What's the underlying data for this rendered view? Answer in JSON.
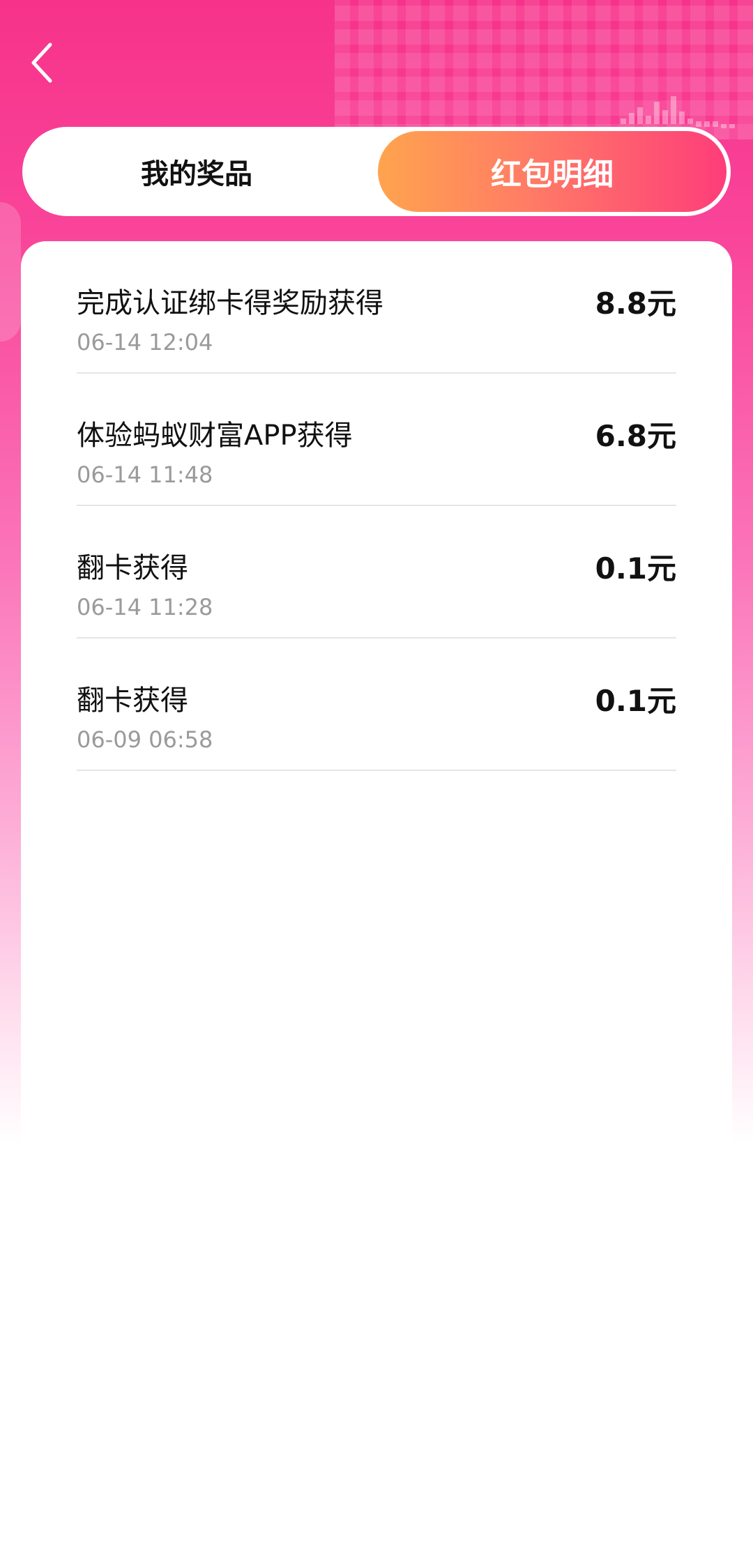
{
  "header": {
    "back_icon": "chevron-left-icon"
  },
  "tabs": [
    {
      "label": "我的奖品",
      "active": false
    },
    {
      "label": "红包明细",
      "active": true
    }
  ],
  "records": [
    {
      "title": "完成认证绑卡得奖励获得",
      "time": "06-14 12:04",
      "amount": "8.8元"
    },
    {
      "title": "体验蚂蚁财富APP获得",
      "time": "06-14 11:48",
      "amount": "6.8元"
    },
    {
      "title": "翻卡获得",
      "time": "06-14 11:28",
      "amount": "0.1元"
    },
    {
      "title": "翻卡获得",
      "time": "06-09 06:58",
      "amount": "0.1元"
    }
  ],
  "colors": {
    "background_top": "#f7328a",
    "tab_active_start": "#ffa44e",
    "tab_active_end": "#fe3d7a",
    "text_primary": "#111111",
    "text_secondary": "#9a9a9a"
  }
}
